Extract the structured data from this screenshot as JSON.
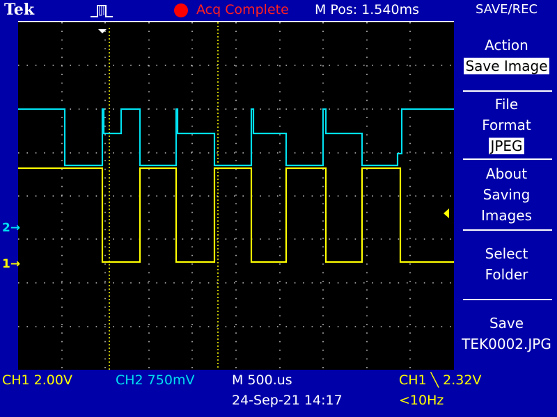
{
  "header": {
    "brand": "Tek",
    "trigger_status_icon": "trigger-pulse-icon",
    "acq_status": "Acq Complete",
    "acq_status_color": "#ff0000",
    "m_pos": "M Pos: 1.540ms"
  },
  "menu": {
    "title": "SAVE/REC",
    "action": {
      "label": "Action",
      "value": "Save Image"
    },
    "file_format": {
      "line1": "File",
      "line2": "Format",
      "value": "JPEG"
    },
    "about": {
      "line1": "About",
      "line2": "Saving",
      "line3": "Images"
    },
    "select_folder": {
      "line1": "Select",
      "line2": "Folder"
    },
    "save": {
      "line1": "Save",
      "line2": "TEK0002.JPG"
    }
  },
  "channels": {
    "ch1": {
      "marker": "1",
      "color": "#ffff00"
    },
    "ch2": {
      "marker": "2",
      "color": "#00e0f0"
    }
  },
  "status": {
    "ch1_scale": "CH1  2.00V",
    "ch2_scale": "CH2  750mV",
    "timebase": "M 500.us",
    "date": "24-Sep-21 14:17",
    "trigger": "CH1 ╲ 2.32V",
    "freq": "<10Hz"
  }
}
